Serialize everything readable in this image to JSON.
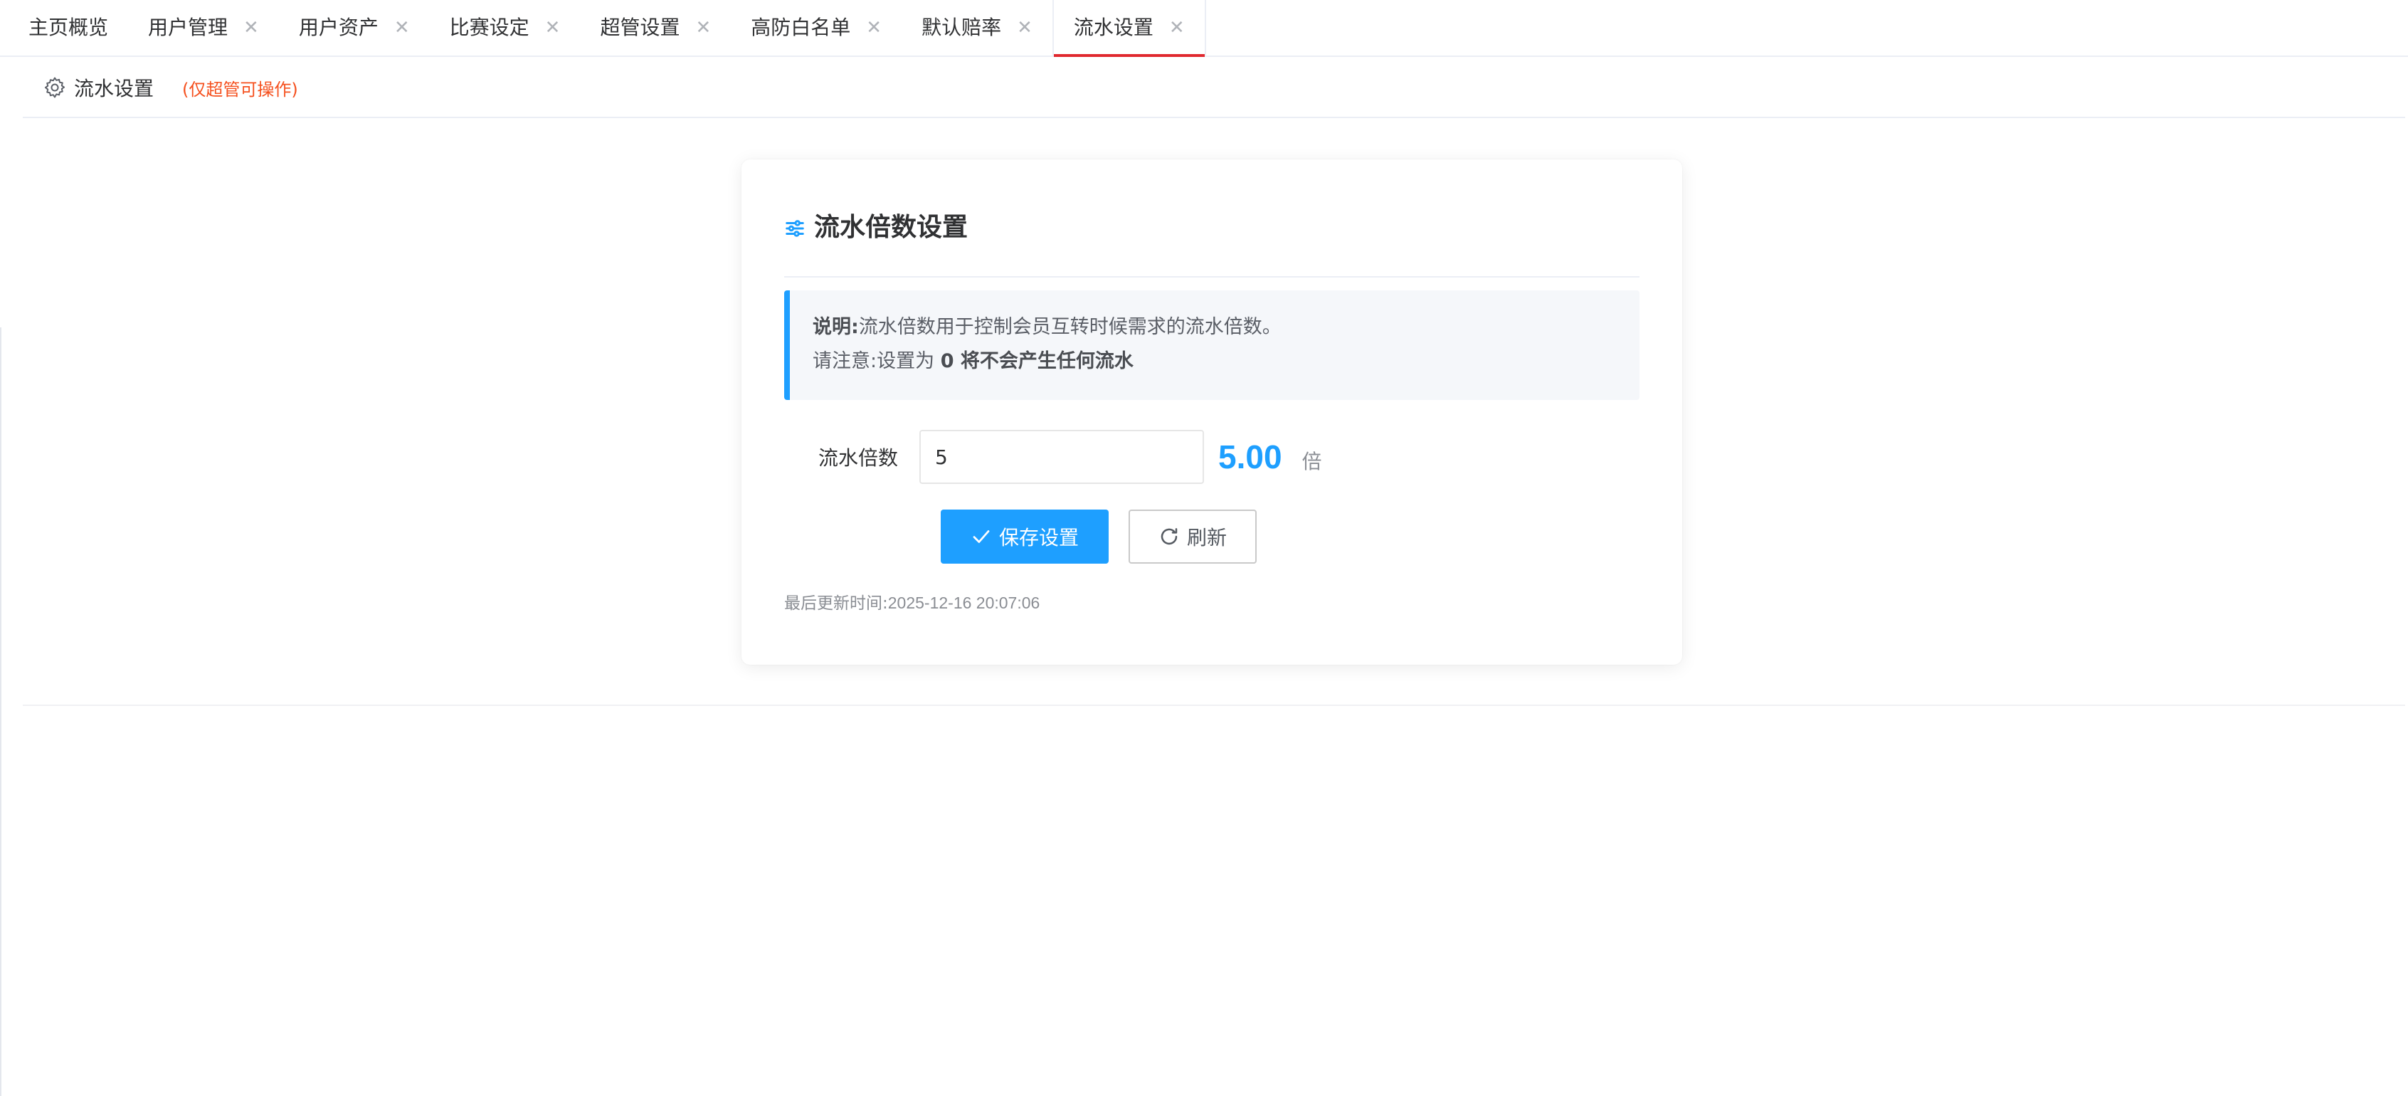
{
  "tabs": [
    {
      "label": "主页概览",
      "closable": false,
      "active": false
    },
    {
      "label": "用户管理",
      "closable": true,
      "active": false
    },
    {
      "label": "用户资产",
      "closable": true,
      "active": false
    },
    {
      "label": "比赛设定",
      "closable": true,
      "active": false
    },
    {
      "label": "超管设置",
      "closable": true,
      "active": false
    },
    {
      "label": "高防白名单",
      "closable": true,
      "active": false
    },
    {
      "label": "默认赔率",
      "closable": true,
      "active": false
    },
    {
      "label": "流水设置",
      "closable": true,
      "active": true
    }
  ],
  "tab_close_glyph": "✕",
  "subheader": {
    "icon": "gear-icon",
    "title": "流水设置",
    "note": "(仅超管可操作)"
  },
  "card": {
    "icon": "sliders-icon",
    "title": "流水倍数设置",
    "info": {
      "line1_label": "说明:",
      "line1_text": "流水倍数用于控制会员互转时候需求的流水倍数。",
      "line2_prefix": "请注意:设置为",
      "line2_strong": "0 将不会产生任何流水"
    },
    "form": {
      "label": "流水倍数",
      "input_value": "5",
      "display_value": "5.00",
      "unit": "倍"
    },
    "buttons": {
      "save_label": "保存设置",
      "refresh_label": "刷新"
    },
    "updated": {
      "label": "最后更新时间:",
      "timestamp": "2025-12-16 20:07:06"
    }
  },
  "colors": {
    "accent": "#1e9fff",
    "active_tab_indicator": "#e0282e",
    "warning_text": "#f5501e"
  }
}
